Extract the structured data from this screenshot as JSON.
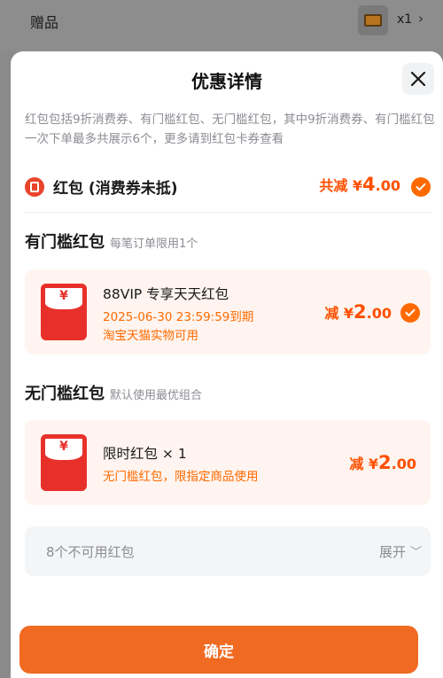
{
  "background": {
    "row_label": "赠品",
    "quantity": "x1",
    "chevron": "›",
    "icons": {
      "thumbnail": "gift-thumbnail-icon"
    }
  },
  "sheet": {
    "title": "优惠详情",
    "close_icon": "close-icon",
    "notice": "红包包括9折消费券、有门槛红包、无门槛红包，其中9折消费券、有门槛红包一次下单最多共展示6个，更多请到红包卡券查看",
    "summary": {
      "label": "红包 (消费券未抵)",
      "total_prefix": "共减 ¥",
      "total_big": "4",
      "total_small": ".00",
      "selected": true
    },
    "threshold_section": {
      "title": "有门槛红包",
      "subtitle": "每笔订单限用1个",
      "coupon": {
        "title": "88VIP 专享天天红包",
        "expiry": "2025-06-30 23:59:59到期",
        "scope": "淘宝天猫实物可用",
        "amount_prefix": "减 ¥",
        "amount_big": "2",
        "amount_small": ".00",
        "selected": true
      }
    },
    "no_threshold_section": {
      "title": "无门槛红包",
      "subtitle": "默认使用最优组合",
      "coupon": {
        "title": "限时红包 × 1",
        "desc": "无门槛红包，限指定商品使用",
        "amount_prefix": "减 ¥",
        "amount_big": "2",
        "amount_small": ".00"
      }
    },
    "unavailable": {
      "label": "8个不可用红包",
      "expand": "展开",
      "chevron": "﹀"
    },
    "confirm_label": "确定"
  },
  "colors": {
    "accent": "#ff5000",
    "check": "#ff6a00",
    "coupon_bg": "#fff4ef",
    "envelope_red": "#e8302a",
    "confirm_bg": "#f06a22"
  },
  "yen_glyph": "¥"
}
